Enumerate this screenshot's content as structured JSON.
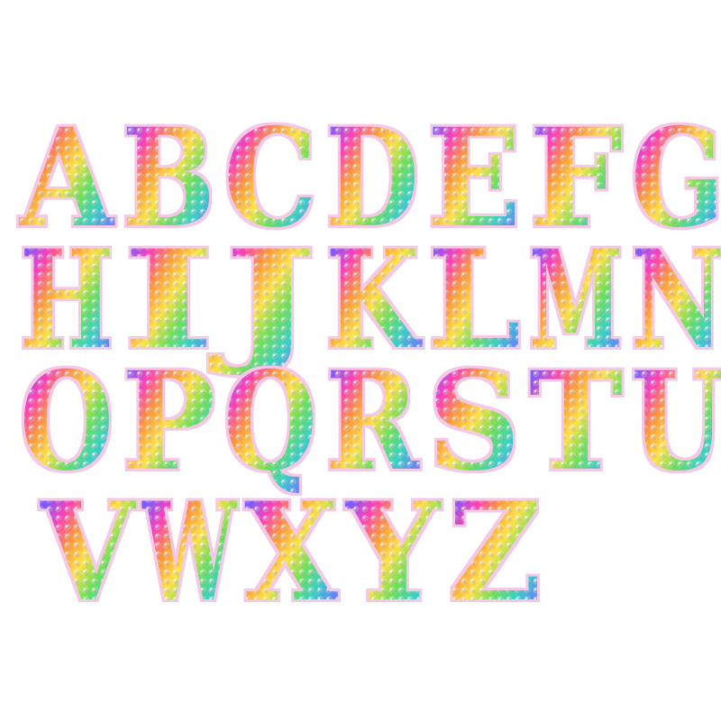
{
  "title": "",
  "letters": [
    "A",
    "B",
    "C",
    "D",
    "E",
    "F",
    "G",
    "H",
    "I",
    "J",
    "K",
    "L",
    "M",
    "N",
    "O",
    "P",
    "Q",
    "R",
    "S",
    "T",
    "U",
    "V",
    "W",
    "X",
    "Y",
    "Z"
  ],
  "rows": [
    [
      "A",
      "B",
      "C",
      "D",
      "E",
      "F",
      "G"
    ],
    [
      "H",
      "I",
      "J",
      "K",
      "L",
      "M",
      "N"
    ],
    [
      "O",
      "P",
      "Q",
      "R",
      "S",
      "T",
      "U"
    ],
    [
      "V",
      "W",
      "X",
      "Y",
      "Z"
    ]
  ],
  "colors": {
    "background": "#ffffff",
    "patch_edge": "#f3c9e6",
    "rainbow": [
      "#c23fff",
      "#7b5cff",
      "#ff3fb8",
      "#ff9a3c",
      "#ffe14a",
      "#6fe05a",
      "#3ad0c6",
      "#6a7dff",
      "#d046ff"
    ]
  },
  "style": {
    "material": "rhinestone-patch",
    "fill": "rainbow-gradient"
  }
}
